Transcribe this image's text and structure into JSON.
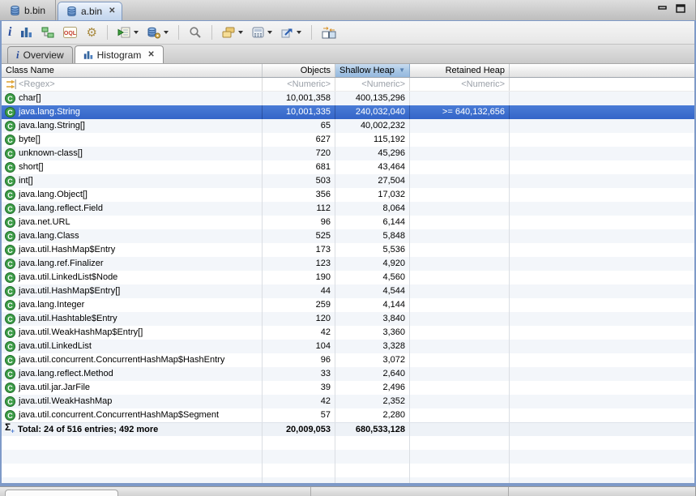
{
  "editor_tabs": [
    {
      "label": "b.bin",
      "active": false
    },
    {
      "label": "a.bin",
      "active": true
    }
  ],
  "window_controls": [
    "minimize",
    "maximize"
  ],
  "toolbar": {
    "oql_label": "OQL",
    "icons": [
      {
        "name": "info-icon"
      },
      {
        "name": "histogram-icon"
      },
      {
        "name": "dominator-tree-icon"
      },
      {
        "name": "oql-icon"
      },
      {
        "name": "expert-system-icon"
      },
      {
        "name": "run-report-icon",
        "dropdown": true
      },
      {
        "name": "heap-dump-icon",
        "dropdown": true
      },
      {
        "name": "search-icon"
      },
      {
        "name": "group-by-icon",
        "dropdown": true
      },
      {
        "name": "calculator-icon",
        "dropdown": true
      },
      {
        "name": "export-icon",
        "dropdown": true
      },
      {
        "name": "compare-icon"
      }
    ]
  },
  "page_tabs": [
    {
      "label": "Overview",
      "active": false
    },
    {
      "label": "Histogram",
      "active": true
    }
  ],
  "table": {
    "class_icon_letter": "C",
    "total_icon": "Σ",
    "columns": [
      {
        "label": "Class Name"
      },
      {
        "label": "Objects"
      },
      {
        "label": "Shallow Heap",
        "sorted": "desc"
      },
      {
        "label": "Retained Heap"
      }
    ],
    "filter": {
      "regex": "<Regex>",
      "numeric": "<Numeric>"
    },
    "rows": [
      {
        "name": "char[]",
        "objects": "10,001,358",
        "shallow": "400,135,296",
        "retained": ""
      },
      {
        "name": "java.lang.String",
        "objects": "10,001,335",
        "shallow": "240,032,040",
        "retained": ">= 640,132,656",
        "selected": true
      },
      {
        "name": "java.lang.String[]",
        "objects": "65",
        "shallow": "40,002,232",
        "retained": ""
      },
      {
        "name": "byte[]",
        "objects": "627",
        "shallow": "115,192",
        "retained": ""
      },
      {
        "name": "unknown-class[]",
        "objects": "720",
        "shallow": "45,296",
        "retained": ""
      },
      {
        "name": "short[]",
        "objects": "681",
        "shallow": "43,464",
        "retained": ""
      },
      {
        "name": "int[]",
        "objects": "503",
        "shallow": "27,504",
        "retained": ""
      },
      {
        "name": "java.lang.Object[]",
        "objects": "356",
        "shallow": "17,032",
        "retained": ""
      },
      {
        "name": "java.lang.reflect.Field",
        "objects": "112",
        "shallow": "8,064",
        "retained": ""
      },
      {
        "name": "java.net.URL",
        "objects": "96",
        "shallow": "6,144",
        "retained": ""
      },
      {
        "name": "java.lang.Class",
        "objects": "525",
        "shallow": "5,848",
        "retained": ""
      },
      {
        "name": "java.util.HashMap$Entry",
        "objects": "173",
        "shallow": "5,536",
        "retained": ""
      },
      {
        "name": "java.lang.ref.Finalizer",
        "objects": "123",
        "shallow": "4,920",
        "retained": ""
      },
      {
        "name": "java.util.LinkedList$Node",
        "objects": "190",
        "shallow": "4,560",
        "retained": ""
      },
      {
        "name": "java.util.HashMap$Entry[]",
        "objects": "44",
        "shallow": "4,544",
        "retained": ""
      },
      {
        "name": "java.lang.Integer",
        "objects": "259",
        "shallow": "4,144",
        "retained": ""
      },
      {
        "name": "java.util.Hashtable$Entry",
        "objects": "120",
        "shallow": "3,840",
        "retained": ""
      },
      {
        "name": "java.util.WeakHashMap$Entry[]",
        "objects": "42",
        "shallow": "3,360",
        "retained": ""
      },
      {
        "name": "java.util.LinkedList",
        "objects": "104",
        "shallow": "3,328",
        "retained": ""
      },
      {
        "name": "java.util.concurrent.ConcurrentHashMap$HashEntry",
        "objects": "96",
        "shallow": "3,072",
        "retained": ""
      },
      {
        "name": "java.lang.reflect.Method",
        "objects": "33",
        "shallow": "2,640",
        "retained": ""
      },
      {
        "name": "java.util.jar.JarFile",
        "objects": "39",
        "shallow": "2,496",
        "retained": ""
      },
      {
        "name": "java.util.WeakHashMap",
        "objects": "42",
        "shallow": "2,352",
        "retained": ""
      },
      {
        "name": "java.util.concurrent.ConcurrentHashMap$Segment",
        "objects": "57",
        "shallow": "2,280",
        "retained": ""
      }
    ],
    "total": {
      "label": "Total: 24 of 516 entries; 492 more",
      "objects": "20,009,053",
      "shallow": "680,533,128",
      "retained": ""
    }
  },
  "colors": {
    "selection": "#3b70d2",
    "sorted_header": "#a6c5e4",
    "row_alt": "#f3f6fa",
    "frame_border": "#7e9ac8",
    "class_icon": "#3f9e49"
  }
}
